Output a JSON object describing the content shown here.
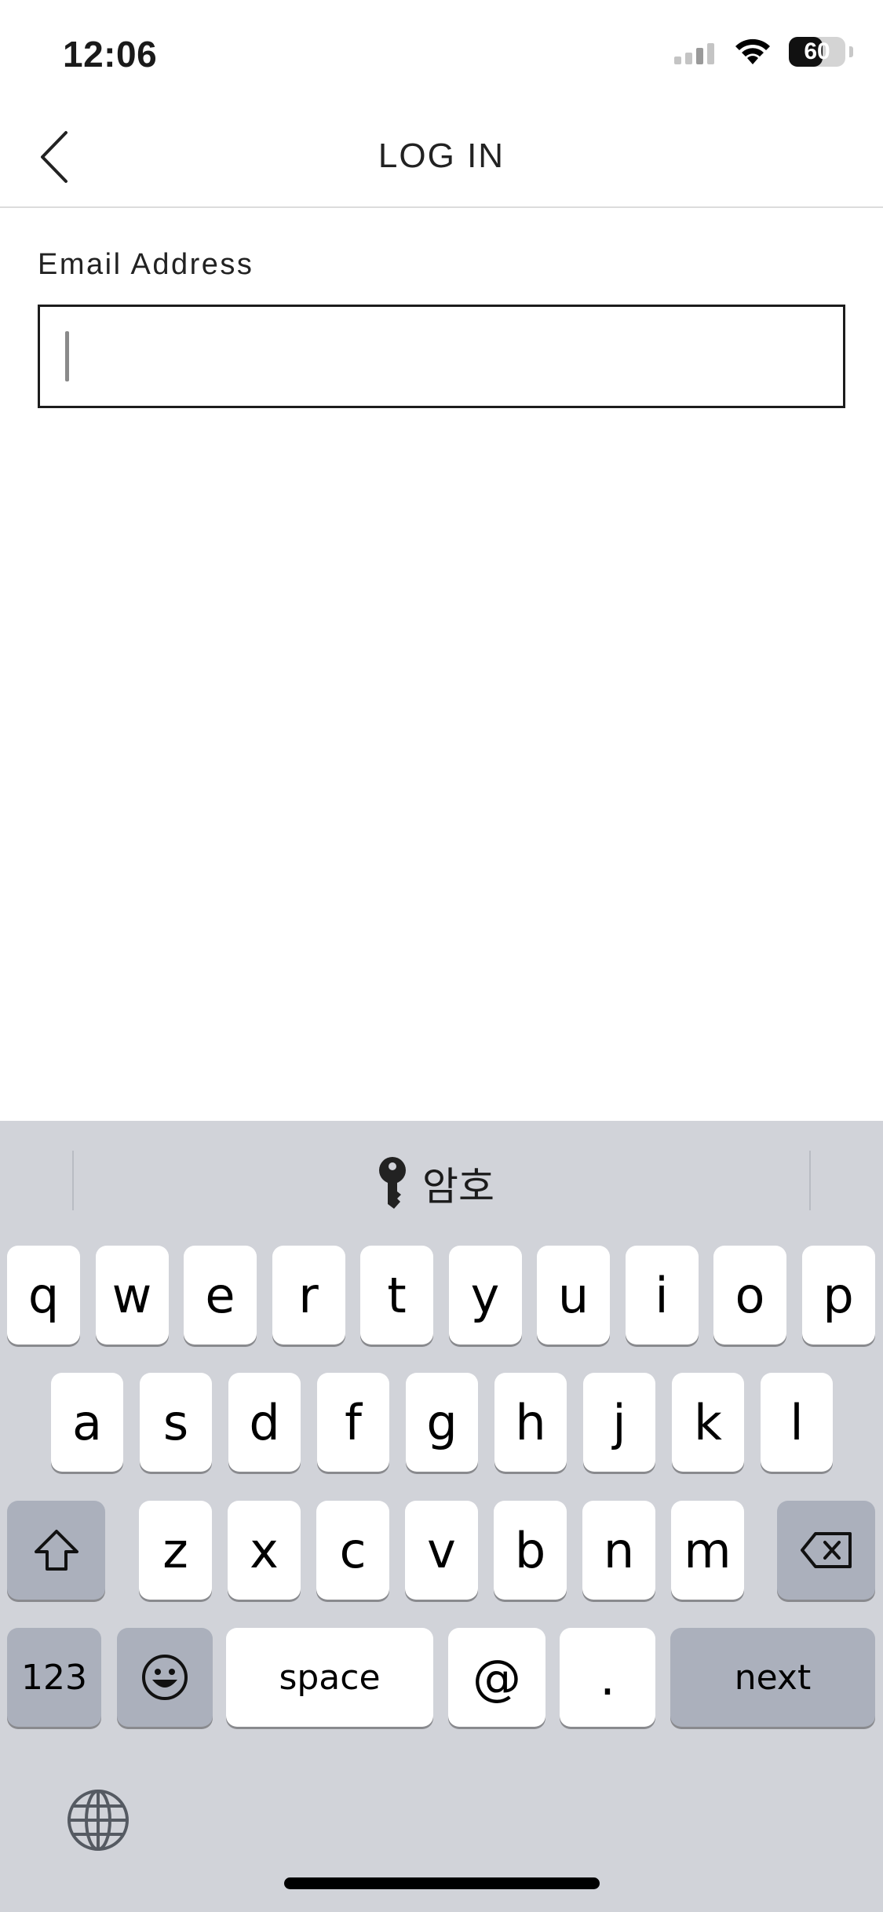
{
  "status_bar": {
    "time": "12:06",
    "battery": "60",
    "battery_level": 0.6
  },
  "header": {
    "title": "LOG IN",
    "back_icon": "chevron-left-icon"
  },
  "form": {
    "email_label": "Email Address",
    "email_value": "",
    "email_placeholder": ""
  },
  "keyboard": {
    "suggestion": {
      "icon": "key-icon",
      "label": "암호"
    },
    "row1": [
      "q",
      "w",
      "e",
      "r",
      "t",
      "y",
      "u",
      "i",
      "o",
      "p"
    ],
    "row2": [
      "a",
      "s",
      "d",
      "f",
      "g",
      "h",
      "j",
      "k",
      "l"
    ],
    "row3": [
      "z",
      "x",
      "c",
      "v",
      "b",
      "n",
      "m"
    ],
    "shift_icon": "shift-icon",
    "delete_icon": "delete-icon",
    "numbers_label": "123",
    "emoji_icon": "emoji-icon",
    "space_label": "space",
    "at_label": "@",
    "dot_label": ".",
    "next_label": "next",
    "globe_icon": "globe-icon"
  },
  "colors": {
    "keyboard_bg": "#d1d3d9",
    "key_light": "#ffffff",
    "key_dark": "#abb0bc",
    "input_border": "#1c1c1c"
  }
}
